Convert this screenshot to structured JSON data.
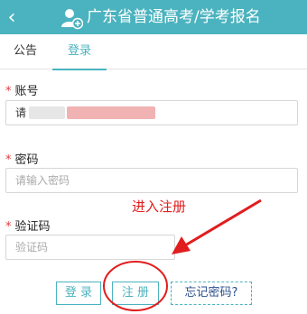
{
  "header": {
    "title": "广东省普通高考/学考报名",
    "back_icon": "chevron-left-icon",
    "app_icon": "user-add-icon"
  },
  "tabs": [
    {
      "label": "公告"
    },
    {
      "label": "登录"
    }
  ],
  "form": {
    "account": {
      "label": "账号",
      "required_mark": "*",
      "value_prefix": "请"
    },
    "password": {
      "label": "密码",
      "required_mark": "*",
      "placeholder": "请输入密码"
    },
    "captcha": {
      "label": "验证码",
      "required_mark": "*",
      "placeholder": "验证码"
    }
  },
  "buttons": {
    "login": "登 录",
    "register": "注 册",
    "forgot": "忘记密码?"
  },
  "annotation": {
    "text": "进入注册",
    "color": "#e11d1d"
  },
  "colors": {
    "accent": "#4bb3bf",
    "required": "#e23b3b"
  }
}
